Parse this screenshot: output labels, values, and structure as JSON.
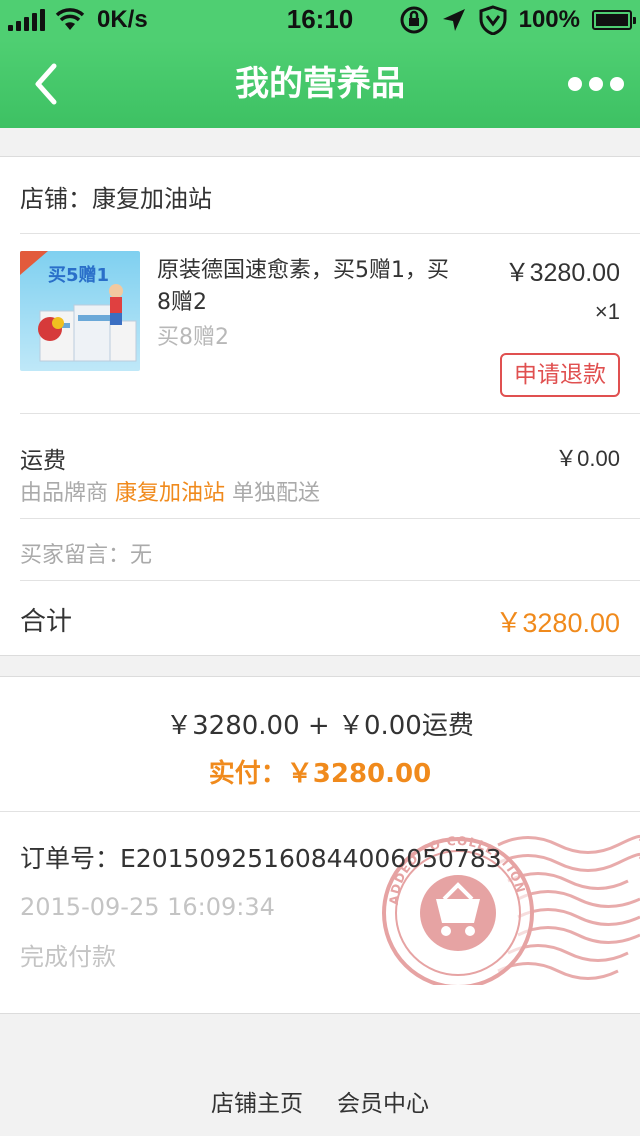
{
  "status_bar": {
    "speed": "0K/s",
    "time": "16:10",
    "battery": "100%"
  },
  "nav": {
    "title": "我的营养品",
    "back_icon": "chevron-left-icon",
    "more_icon": "more-dots-icon"
  },
  "order": {
    "store_label": "店铺：康复加油站",
    "product": {
      "image_text": "买5赠1",
      "name": "原装德国速愈素，买5赠1，买8赠2",
      "spec": "买8赠2",
      "price": "￥3280.00",
      "quantity": "×1",
      "refund_button": "申请退款"
    },
    "freight": {
      "label": "运费",
      "value": "￥0.00",
      "note_prefix": "由品牌商",
      "note_store": "康复加油站",
      "note_suffix": "单独配送"
    },
    "buyer_message": "买家留言：无",
    "total": {
      "label": "合计",
      "value": "￥3280.00"
    }
  },
  "payment": {
    "breakdown": "￥3280.00 + ￥0.00运费",
    "paid": "实付：￥3280.00",
    "order_number": "订单号：E20150925160844006050783",
    "order_time": "2015-09-25 16:09:34",
    "status": "完成付款",
    "stamp_text": "ADDED TO COLLECTION"
  },
  "footer": {
    "links": [
      "店铺主页",
      "会员中心"
    ]
  },
  "colors": {
    "nav_green": "#3dc163",
    "accent_orange": "#f08a1c",
    "refund_red": "#e05050"
  }
}
